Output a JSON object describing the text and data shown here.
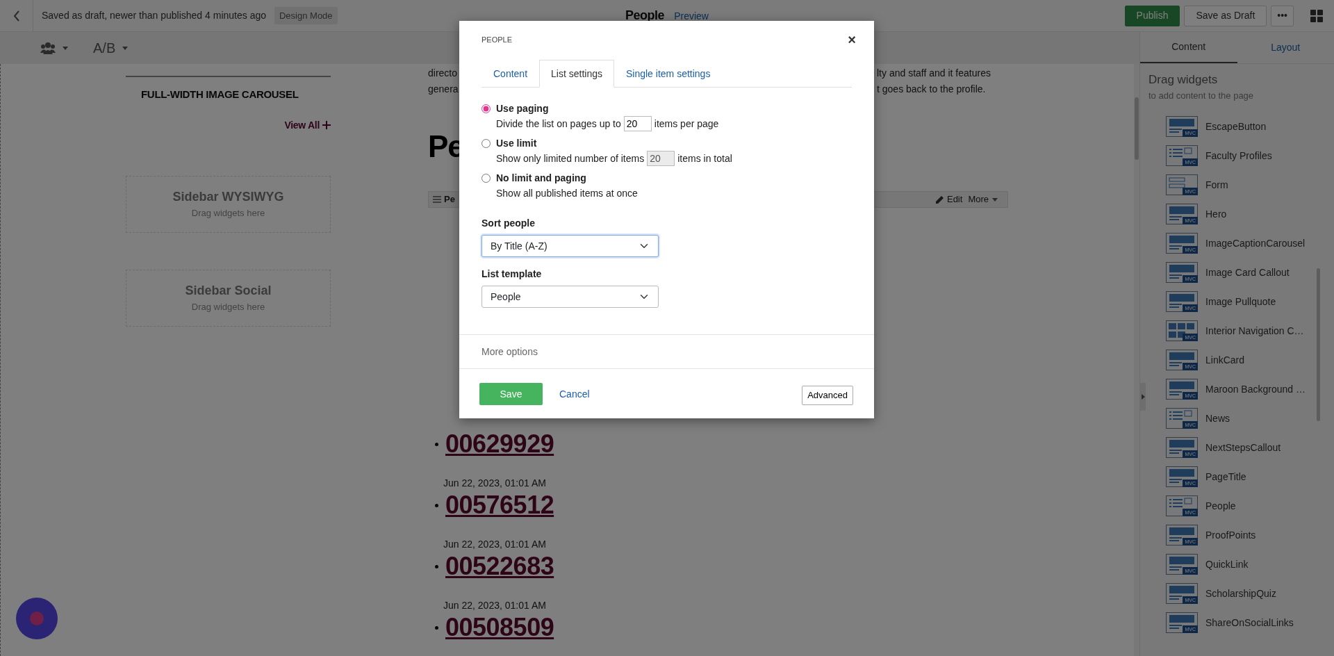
{
  "top_bar": {
    "status": "Saved as draft, newer than published 4 minutes ago",
    "mode_badge": "Design Mode",
    "page_title": "People",
    "preview_link": "Preview",
    "buttons": [
      {
        "label": "Publish",
        "kind": "primary"
      },
      {
        "label": "Save as Draft",
        "kind": "secondary"
      },
      {
        "label": "•••",
        "kind": "more"
      }
    ]
  },
  "toolbar": {
    "ab_label": "A/B"
  },
  "left_column": {
    "carousel_title": "FULL-WIDTH IMAGE CAROUSEL",
    "view_all": "View All",
    "placeholders": [
      {
        "title": "Sidebar WYSIWYG",
        "hint": "Drag widgets here"
      },
      {
        "title": "Sidebar Social",
        "hint": "Drag widgets here"
      }
    ]
  },
  "content": {
    "paragraph_lines": [
      {
        "left": "directo",
        "right": "lty and staff and it features"
      },
      {
        "left": "genera",
        "right": "t goes back to the profile."
      }
    ],
    "heading": "Pe",
    "widget_bar": {
      "label": "Pe",
      "edit": "Edit",
      "more": "More"
    },
    "people": [
      {
        "title": "00629929",
        "date": "Jun 22, 2023, 01:01 AM"
      },
      {
        "title": "00576512",
        "date": "Jun 22, 2023, 01:01 AM"
      },
      {
        "title": "00522683",
        "date": "Jun 22, 2023, 01:01 AM"
      },
      {
        "title": "00508509"
      }
    ]
  },
  "right_panel": {
    "tabs": [
      {
        "label": "Content",
        "selected": true
      },
      {
        "label": "Layout",
        "selected": false
      }
    ],
    "heading": "Drag widgets",
    "subheading": "to add content to the page",
    "widgets": [
      {
        "name": "EscapeButton",
        "kind": "banner",
        "badge": "MVC"
      },
      {
        "name": "Faculty Profiles",
        "kind": "list",
        "badge": "MVC"
      },
      {
        "name": "Form",
        "kind": "form",
        "badge": "MVC"
      },
      {
        "name": "Hero",
        "kind": "banner",
        "badge": "MVC"
      },
      {
        "name": "ImageCaptionCarousel",
        "kind": "banner",
        "badge": "MVC"
      },
      {
        "name": "Image Card Callout",
        "kind": "banner",
        "badge": "MVC"
      },
      {
        "name": "Image Pullquote",
        "kind": "banner",
        "badge": "MVC"
      },
      {
        "name": "Interior Navigation C…",
        "kind": "grid",
        "badge": "MVC"
      },
      {
        "name": "LinkCard",
        "kind": "banner",
        "badge": "MVC"
      },
      {
        "name": "Maroon Background …",
        "kind": "banner",
        "badge": "MVC"
      },
      {
        "name": "News",
        "kind": "list",
        "badge": "MVC"
      },
      {
        "name": "NextStepsCallout",
        "kind": "banner",
        "badge": "MVC"
      },
      {
        "name": "PageTitle",
        "kind": "banner",
        "badge": "MVC"
      },
      {
        "name": "People",
        "kind": "list",
        "badge": "MVC"
      },
      {
        "name": "ProofPoints",
        "kind": "banner",
        "badge": "MVC"
      },
      {
        "name": "QuickLink",
        "kind": "banner",
        "badge": "MVC"
      },
      {
        "name": "ScholarshipQuiz",
        "kind": "banner",
        "badge": "MVC"
      },
      {
        "name": "ShareOnSocialLinks",
        "kind": "banner",
        "badge": "MVC"
      }
    ]
  },
  "dialog": {
    "title": "PEOPLE",
    "close": "×",
    "tabs": [
      {
        "label": "Content",
        "selected": false
      },
      {
        "label": "List settings",
        "selected": true
      },
      {
        "label": "Single item settings",
        "selected": false
      }
    ],
    "options": [
      {
        "label": "Use paging",
        "selected": true,
        "before": "Divide the list on pages up to",
        "value": "20",
        "after": "items per page",
        "disabled": false
      },
      {
        "label": "Use limit",
        "selected": false,
        "before": "Show only limited number of items",
        "value": "20",
        "after": "items in total",
        "disabled": true
      },
      {
        "label": "No limit and paging",
        "selected": false,
        "before": "Show all published items at once"
      }
    ],
    "sort": {
      "label": "Sort people",
      "value": "By Title (A-Z)",
      "focused": true
    },
    "template": {
      "label": "List template",
      "value": "People",
      "focused": false
    },
    "more_options": "More options",
    "save": "Save",
    "cancel": "Cancel",
    "advanced": "Advanced"
  }
}
